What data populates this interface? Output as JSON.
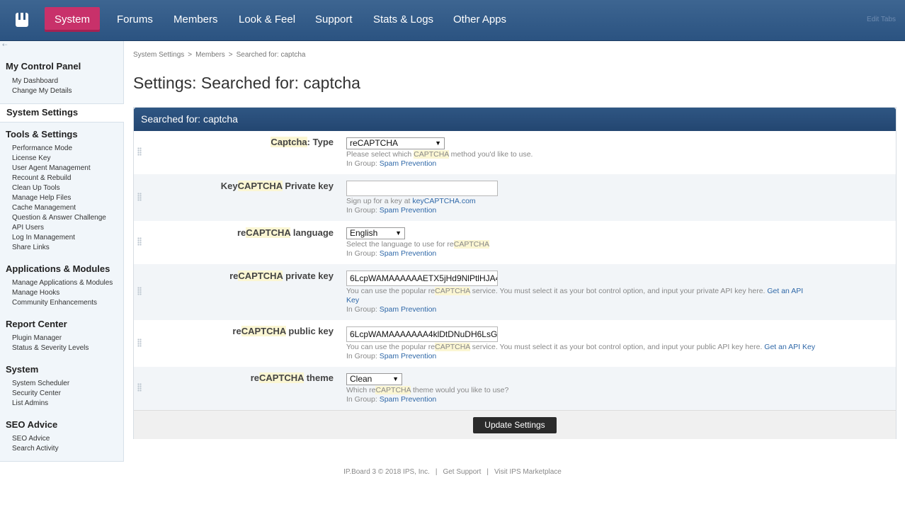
{
  "nav": {
    "tabs": [
      "System",
      "Forums",
      "Members",
      "Look & Feel",
      "Support",
      "Stats & Logs",
      "Other Apps"
    ],
    "edit_tabs": "Edit Tabs"
  },
  "sidebar": {
    "sections": [
      {
        "heading": "My Control Panel",
        "items": [
          "My Dashboard",
          "Change My Details"
        ]
      },
      {
        "heading": "System Settings",
        "items": []
      },
      {
        "heading": "Tools & Settings",
        "items": [
          "Performance Mode",
          "License Key",
          "User Agent Management",
          "Recount & Rebuild",
          "Clean Up Tools",
          "Manage Help Files",
          "Cache Management",
          "Question & Answer Challenge",
          "API Users",
          "Log In Management",
          "Share Links"
        ]
      },
      {
        "heading": "Applications & Modules",
        "items": [
          "Manage Applications & Modules",
          "Manage Hooks",
          "Community Enhancements"
        ]
      },
      {
        "heading": "Report Center",
        "items": [
          "Plugin Manager",
          "Status & Severity Levels"
        ]
      },
      {
        "heading": "System",
        "items": [
          "System Scheduler",
          "Security Center",
          "List Admins"
        ]
      },
      {
        "heading": "SEO Advice",
        "items": [
          "SEO Advice",
          "Search Activity"
        ]
      }
    ]
  },
  "breadcrumb": [
    "System Settings",
    "Members",
    "Searched for: captcha"
  ],
  "page_title": "Settings: Searched for: captcha",
  "panel_title": "Searched for: captcha",
  "settings": [
    {
      "label_pre": "",
      "label_hl": "Captcha",
      "label_post": ": Type",
      "control": "select",
      "value": "reCAPTCHA",
      "desc_pre": "Please select which ",
      "desc_hl": "CAPTCHA",
      "desc_post": " method you'd like to use.",
      "group_label": "In Group: ",
      "group": "Spam Prevention"
    },
    {
      "label_pre": "Key",
      "label_hl": "CAPTCHA",
      "label_post": " Private key",
      "control": "text",
      "value": "",
      "desc_pre": "Sign up for a key at ",
      "desc_link": "keyCAPTCHA.com",
      "group_label": "In Group: ",
      "group": "Spam Prevention"
    },
    {
      "label_pre": "re",
      "label_hl": "CAPTCHA",
      "label_post": " language",
      "control": "select",
      "value": "English",
      "desc_pre": "Select the language to use for re",
      "desc_hl": "CAPTCHA",
      "desc_post": "",
      "group_label": "In Group: ",
      "group": "Spam Prevention"
    },
    {
      "label_pre": "re",
      "label_hl": "CAPTCHA",
      "label_post": " private key",
      "control": "text",
      "value": "6LcpWAMAAAAAAETX5jHd9NlPtlHJA4",
      "desc_pre": "You can use the popular re",
      "desc_hl": "CAPTCHA",
      "desc_post": " service. You must select it as your bot control option, and input your private API key here. ",
      "desc_link": "Get an API",
      "desc_link2": "Key",
      "group_label": "In Group: ",
      "group": "Spam Prevention"
    },
    {
      "label_pre": "re",
      "label_hl": "CAPTCHA",
      "label_post": " public key",
      "control": "text",
      "value": "6LcpWAMAAAAAAA4klDtDNuDH6LsG",
      "desc_pre": "You can use the popular re",
      "desc_hl": "CAPTCHA",
      "desc_post": " service. You must select it as your bot control option, and input your public API key here. ",
      "desc_link": "Get an API Key",
      "group_label": "In Group: ",
      "group": "Spam Prevention"
    },
    {
      "label_pre": "re",
      "label_hl": "CAPTCHA",
      "label_post": " theme",
      "control": "select",
      "value": "Clean",
      "desc_pre": "Which re",
      "desc_hl": "CAPTCHA",
      "desc_post": " theme would you like to use?",
      "group_label": "In Group: ",
      "group": "Spam Prevention"
    }
  ],
  "submit_label": "Update Settings",
  "footer": {
    "copyright": "IP.Board 3 © 2018 IPS, Inc.",
    "support": "Get Support",
    "marketplace": "Visit IPS Marketplace"
  },
  "colors": {
    "topbar": "#2f5683",
    "active_tab": "#c8316a",
    "highlight": "#fbf6d3",
    "link": "#2f68a8"
  }
}
